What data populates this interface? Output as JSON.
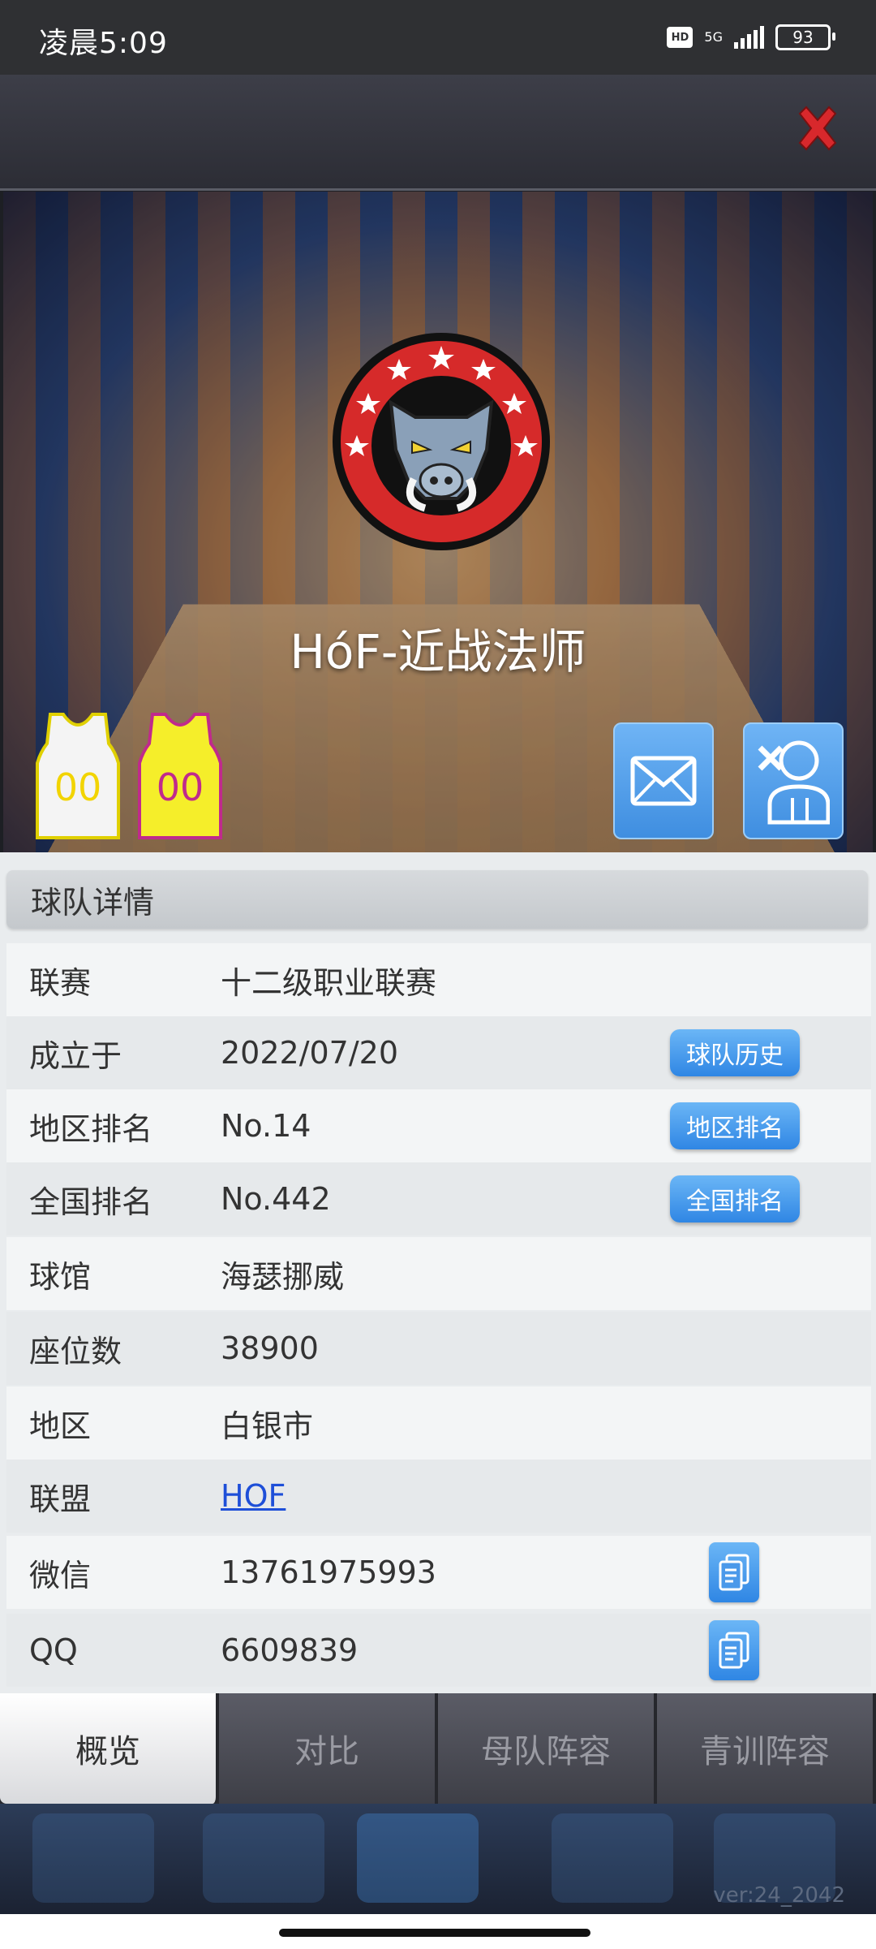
{
  "status_bar": {
    "time": "凌晨5:09",
    "hd_label": "HD",
    "network": "5G",
    "battery": "93"
  },
  "banner": {
    "team_name": "HóF-近战法师",
    "jersey_home_number": "00",
    "jersey_away_number": "00"
  },
  "detail": {
    "header": "球队详情",
    "rows": [
      {
        "key": "联赛",
        "value": "十二级职业联赛"
      },
      {
        "key": "成立于",
        "value": "2022/07/20",
        "button": "球队历史"
      },
      {
        "key": "地区排名",
        "value": "No.14",
        "button": "地区排名"
      },
      {
        "key": "全国排名",
        "value": "No.442",
        "button": "全国排名"
      },
      {
        "key": "球馆",
        "value": "海瑟挪威"
      },
      {
        "key": "座位数",
        "value": "38900"
      },
      {
        "key": "地区",
        "value": "白银市"
      },
      {
        "key": "联盟",
        "value": "HOF"
      },
      {
        "key": "微信",
        "value": "13761975993"
      },
      {
        "key": "QQ",
        "value": "6609839"
      }
    ]
  },
  "tabs": [
    {
      "label": "概览",
      "active": true
    },
    {
      "label": "对比",
      "active": false
    },
    {
      "label": "母队阵容",
      "active": false
    },
    {
      "label": "青训阵容",
      "active": false
    }
  ],
  "version": "ver:24_2042",
  "colors": {
    "accent_blue": "#3f8ee0",
    "close_red": "#d8282c",
    "link": "#1e4fd8"
  }
}
